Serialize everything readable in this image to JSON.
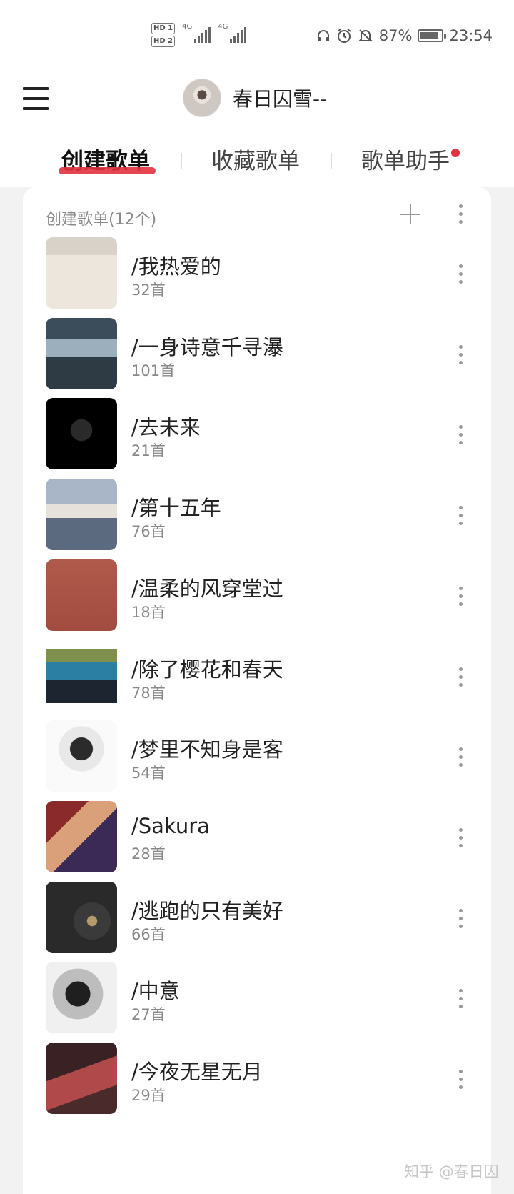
{
  "status_bar": {
    "hd1": "HD 1",
    "hd2": "HD 2",
    "net1": "4G",
    "net2": "4G",
    "battery_level": 0.87,
    "battery_text": "87%",
    "time": "23:54"
  },
  "header": {
    "menu_icon": "hamburger-menu-icon",
    "user_name": "春日囚雪--"
  },
  "tabs": [
    {
      "label": "创建歌单",
      "active": true
    },
    {
      "label": "收藏歌单",
      "active": false
    },
    {
      "label": "歌单助手",
      "active": false,
      "has_notification": true
    }
  ],
  "section": {
    "title": "创建歌单(12个)",
    "add_icon": "plus-icon",
    "more_icon": "vertical-ellipsis-icon"
  },
  "playlists": [
    {
      "name": "/我热爱的",
      "count": "32首"
    },
    {
      "name": "/一身诗意千寻瀑",
      "count": "101首"
    },
    {
      "name": "/去未来",
      "count": "21首"
    },
    {
      "name": "/第十五年",
      "count": "76首"
    },
    {
      "name": "/温柔的风穿堂过",
      "count": "18首"
    },
    {
      "name": "/除了樱花和春天",
      "count": "78首"
    },
    {
      "name": "/梦里不知身是客",
      "count": "54首"
    },
    {
      "name": "/Sakura",
      "count": "28首"
    },
    {
      "name": "/逃跑的只有美好",
      "count": "66首"
    },
    {
      "name": "/中意",
      "count": "27首"
    },
    {
      "name": "/今夜无星无月",
      "count": "29首"
    }
  ],
  "watermark": "知乎 @春日囚",
  "colors": {
    "accent": "#e2333f",
    "background": "#f2f2f2"
  }
}
